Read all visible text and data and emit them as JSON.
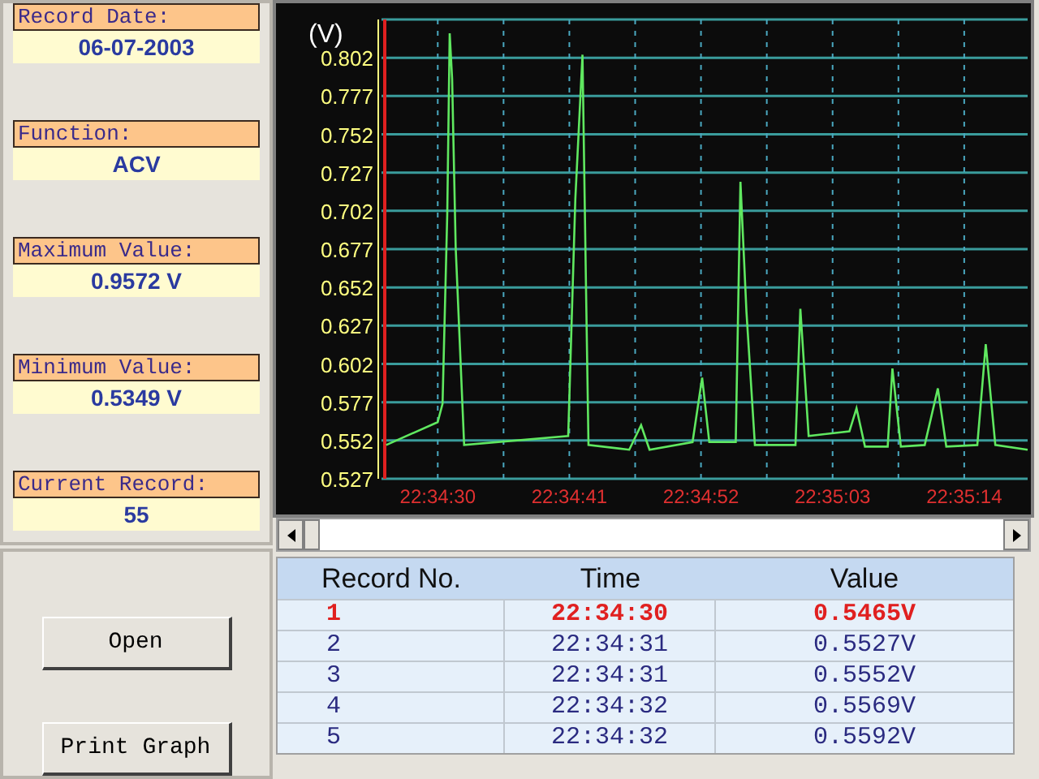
{
  "info_fields": [
    {
      "label": "Record Date:",
      "value": "06-07-2003"
    },
    {
      "label": "Function:",
      "value": "ACV"
    },
    {
      "label": "Maximum Value:",
      "value": "0.9572 V"
    },
    {
      "label": "Minimum Value:",
      "value": "0.5349 V"
    },
    {
      "label": "Current Record:",
      "value": "55"
    }
  ],
  "buttons": [
    "Open",
    "Print Graph"
  ],
  "graph": {
    "chart_data": {
      "type": "line",
      "grid": true,
      "ylabel": "(V)",
      "xlim": [
        81265.3,
        81319.3
      ],
      "ylim": [
        0.527,
        0.827
      ],
      "xticks": [
        {
          "value": 81270,
          "label": "22:34:30"
        },
        {
          "value": 81281,
          "label": "22:34:41"
        },
        {
          "value": 81292,
          "label": "22:34:52"
        },
        {
          "value": 81303,
          "label": "22:35:03"
        },
        {
          "value": 81314,
          "label": "22:35:14"
        }
      ],
      "yticks": [
        0.527,
        0.552,
        0.577,
        0.602,
        0.627,
        0.652,
        0.677,
        0.702,
        0.727,
        0.752,
        0.777,
        0.802
      ],
      "x": [
        81265.7,
        81270,
        81270.4,
        81270.8,
        81271,
        81271.2,
        81271.5,
        81272.2,
        81280.9,
        81281.5,
        81282.1,
        81282.4,
        81282.6,
        81286,
        81287,
        81287.7,
        81291.3,
        81292.1,
        81292.7,
        81294.9,
        81295.3,
        81295.8,
        81296.5,
        81299.9,
        81300.3,
        81301,
        81304.4,
        81305,
        81305.7,
        81307.6,
        81308,
        81308.7,
        81310.7,
        81311.8,
        81312.5,
        81315.1,
        81315.8,
        81316.6,
        81319.3
      ],
      "series": [
        {
          "color": "#60e860",
          "values": [
            0.549,
            0.564,
            0.576,
            0.7,
            0.818,
            0.788,
            0.678,
            0.549,
            0.555,
            0.71,
            0.804,
            0.65,
            0.549,
            0.546,
            0.562,
            0.546,
            0.551,
            0.593,
            0.551,
            0.551,
            0.721,
            0.636,
            0.549,
            0.549,
            0.638,
            0.555,
            0.558,
            0.573,
            0.548,
            0.548,
            0.599,
            0.548,
            0.549,
            0.586,
            0.548,
            0.549,
            0.615,
            0.549,
            0.546
          ]
        }
      ]
    }
  },
  "table": {
    "columns": [
      "Record No.",
      "Time",
      "Value"
    ],
    "rows": [
      {
        "cells": [
          "1",
          "22:34:30",
          "0.5465V"
        ],
        "selected": true
      },
      {
        "cells": [
          "2",
          "22:34:31",
          "0.5527V"
        ],
        "selected": false
      },
      {
        "cells": [
          "3",
          "22:34:31",
          "0.5552V"
        ],
        "selected": false
      },
      {
        "cells": [
          "4",
          "22:34:32",
          "0.5569V"
        ],
        "selected": false
      },
      {
        "cells": [
          "5",
          "22:34:32",
          "0.5592V"
        ],
        "selected": false
      }
    ]
  }
}
